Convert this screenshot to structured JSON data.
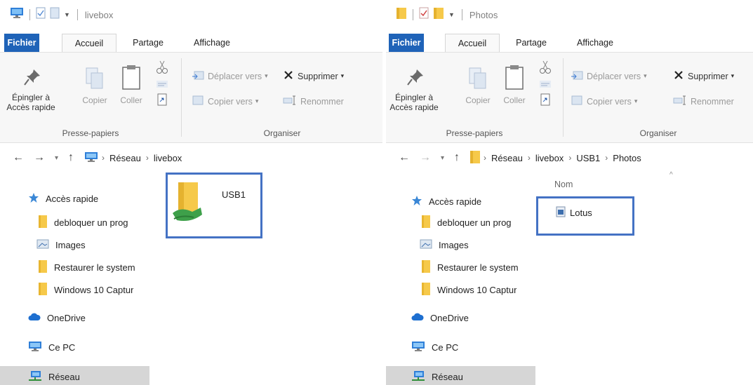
{
  "left": {
    "title": "livebox",
    "tabs": {
      "file": "Fichier",
      "home": "Accueil",
      "share": "Partage",
      "view": "Affichage"
    },
    "ribbon": {
      "pin": "Épingler à Accès rapide",
      "copy": "Copier",
      "paste": "Coller",
      "clipboard_group": "Presse-papiers",
      "move_to": "Déplacer vers",
      "copy_to": "Copier vers",
      "delete": "Supprimer",
      "rename": "Renommer",
      "organize_group": "Organiser"
    },
    "address": {
      "crumbs": [
        "Réseau",
        "livebox"
      ]
    },
    "sidebar": [
      {
        "label": "Accès rapide",
        "icon": "star-icon"
      },
      {
        "label": "debloquer un prog",
        "icon": "folder-icon"
      },
      {
        "label": "Images",
        "icon": "images-icon"
      },
      {
        "label": "Restaurer le system",
        "icon": "folder-icon"
      },
      {
        "label": "Windows 10 Captur",
        "icon": "folder-icon"
      },
      {
        "label": "OneDrive",
        "icon": "cloud-icon"
      },
      {
        "label": "Ce PC",
        "icon": "pc-icon"
      },
      {
        "label": "Réseau",
        "icon": "network-icon"
      }
    ],
    "item": {
      "label": "USB1",
      "icon": "shared-folder-icon"
    }
  },
  "right": {
    "title": "Photos",
    "tabs": {
      "file": "Fichier",
      "home": "Accueil",
      "share": "Partage",
      "view": "Affichage"
    },
    "ribbon": {
      "pin": "Épingler à Accès rapide",
      "copy": "Copier",
      "paste": "Coller",
      "clipboard_group": "Presse-papiers",
      "move_to": "Déplacer vers",
      "copy_to": "Copier vers",
      "delete": "Supprimer",
      "rename": "Renommer",
      "organize_group": "Organiser"
    },
    "address": {
      "crumbs": [
        "Réseau",
        "livebox",
        "USB1",
        "Photos"
      ]
    },
    "column_header": "Nom",
    "sidebar": [
      {
        "label": "Accès rapide",
        "icon": "star-icon"
      },
      {
        "label": "debloquer un prog",
        "icon": "folder-icon"
      },
      {
        "label": "Images",
        "icon": "images-icon"
      },
      {
        "label": "Restaurer le system",
        "icon": "folder-icon"
      },
      {
        "label": "Windows 10 Captur",
        "icon": "folder-icon"
      },
      {
        "label": "OneDrive",
        "icon": "cloud-icon"
      },
      {
        "label": "Ce PC",
        "icon": "pc-icon"
      },
      {
        "label": "Réseau",
        "icon": "network-icon"
      }
    ],
    "item": {
      "label": "Lotus",
      "icon": "image-file-icon"
    }
  },
  "colors": {
    "accent": "#1f63b8",
    "highlight": "#4472c4",
    "folder": "#f6c94a",
    "selected": "#d6d6d6"
  }
}
